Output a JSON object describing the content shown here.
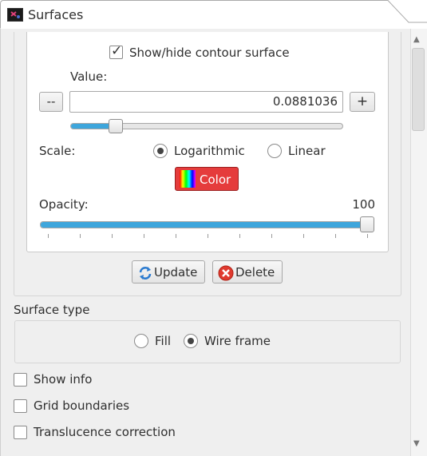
{
  "window": {
    "tab_title": "Surfaces"
  },
  "contour": {
    "show_hide_label": "Show/hide contour surface",
    "show_hide_checked": true,
    "value_label": "Value:",
    "decrement_label": "--",
    "increment_label": "+",
    "value": "0.0881036",
    "value_slider_fraction": 0.14,
    "scale_label": "Scale:",
    "scale_options": [
      "Logarithmic",
      "Linear"
    ],
    "scale_selected": "Logarithmic",
    "color_button_label": "Color",
    "opacity_label": "Opacity:",
    "opacity_value": "100"
  },
  "actions": {
    "update_label": "Update",
    "delete_label": "Delete"
  },
  "surface_type": {
    "heading": "Surface type",
    "options": [
      "Fill",
      "Wire frame"
    ],
    "selected": "Wire frame"
  },
  "options": [
    {
      "label": "Show info",
      "checked": false
    },
    {
      "label": "Grid boundaries",
      "checked": false
    },
    {
      "label": "Translucence correction",
      "checked": false
    }
  ],
  "colors": {
    "accent": "#3ea6dc",
    "color_button": "#e53c3c"
  }
}
